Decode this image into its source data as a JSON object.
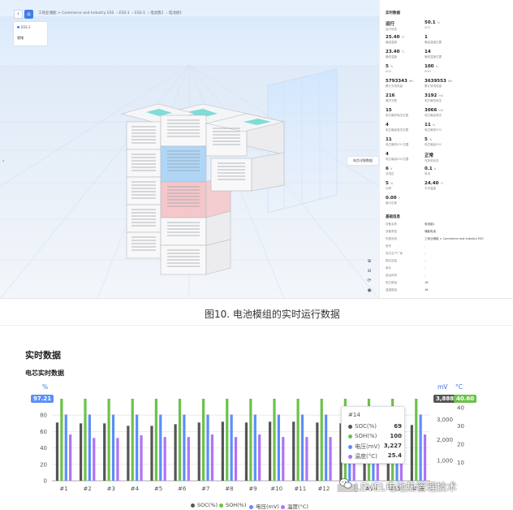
{
  "viewer": {
    "breadcrumb": [
      "工商业储能 > Commerce and Industry ESS",
      "ESS-1",
      "ESS-1",
      "电池簇1",
      "电池组1"
    ],
    "card": {
      "title": "ESS-1",
      "status": "就绪"
    },
    "side_tab_label": "电芯详细数据",
    "panel": {
      "title": "实时数据",
      "metrics": [
        {
          "value": "运行",
          "unit": "",
          "label": "运行状态"
        },
        {
          "value": "50.1",
          "unit": "%",
          "label": "SOC"
        },
        {
          "value": "25.40",
          "unit": "°C",
          "label": "最高温度"
        },
        {
          "value": "1",
          "unit": "",
          "label": "最高温度位置"
        },
        {
          "value": "23.40",
          "unit": "°C",
          "label": "最低温度"
        },
        {
          "value": "14",
          "unit": "",
          "label": "最低温度位置"
        },
        {
          "value": "5",
          "unit": "%",
          "label": "SOC"
        },
        {
          "value": "100",
          "unit": "%",
          "label": "SOH"
        },
        {
          "value": "5793343",
          "unit": "Wh",
          "label": "累计充电电量"
        },
        {
          "value": "3639553",
          "unit": "Wh",
          "label": "累计放电电量"
        },
        {
          "value": "216",
          "unit": "",
          "label": "循环次数"
        },
        {
          "value": "3192",
          "unit": "mV",
          "label": "电芯最低电压"
        },
        {
          "value": "15",
          "unit": "",
          "label": "电芯最低电压位置"
        },
        {
          "value": "3066",
          "unit": "mV",
          "label": "电芯最高电压"
        },
        {
          "value": "4",
          "unit": "",
          "label": "电芯最高电压位置"
        },
        {
          "value": "11",
          "unit": "%",
          "label": "电芯最低SOC"
        },
        {
          "value": "11",
          "unit": "",
          "label": "电芯最低SOC位置"
        },
        {
          "value": "5",
          "unit": "%",
          "label": "电芯最高SOC"
        },
        {
          "value": "4",
          "unit": "",
          "label": "电芯最高SOC位置"
        },
        {
          "value": "正常",
          "unit": "",
          "label": "充放电状态"
        },
        {
          "value": "6",
          "unit": "V",
          "label": "总电压"
        },
        {
          "value": "0.1",
          "unit": "A",
          "label": "电流"
        },
        {
          "value": "5",
          "unit": "%",
          "label": "功率"
        },
        {
          "value": "24.40",
          "unit": "°C",
          "label": "平均温度"
        },
        {
          "value": "0.00",
          "unit": "V",
          "label": "最大压差"
        }
      ],
      "info_title": "基础信息",
      "info": [
        {
          "label": "设备名称",
          "value": "电池组1"
        },
        {
          "label": "设备类型",
          "value": "储能电池"
        },
        {
          "label": "所属系统",
          "value": "工商业储能 > Commerce and Industry ESS"
        },
        {
          "label": "型号",
          "value": "-"
        },
        {
          "label": "电芯生产厂家",
          "value": "-"
        },
        {
          "label": "额定容量",
          "value": "-"
        },
        {
          "label": "串并",
          "value": "-"
        },
        {
          "label": "投运时间",
          "value": "-"
        },
        {
          "label": "电芯数量",
          "value": "16"
        },
        {
          "label": "温度数量",
          "value": "16"
        }
      ]
    }
  },
  "caption_top": "图10. 电池模组的实时运行数据",
  "section": {
    "title": "实时数据",
    "subtitle": "电芯实时数据"
  },
  "axes": {
    "left_unit": "%",
    "right_unit_mv": "mV",
    "right_unit_c": "°C",
    "left_marker": "97.21",
    "right_marker_mv": "3,888.37",
    "right_marker_c": "40.60"
  },
  "tooltip": {
    "title": "#14",
    "rows": [
      {
        "name": "SOC(%)",
        "value": "69",
        "color": "#555555"
      },
      {
        "name": "SOH(%)",
        "value": "100",
        "color": "#6cc24a"
      },
      {
        "name": "电压(mV)",
        "value": "3,227",
        "color": "#5b8ff9"
      },
      {
        "name": "温度(°C)",
        "value": "25.4",
        "color": "#b072f5"
      }
    ]
  },
  "watermark": "LEVEL电池热管理技术",
  "chart_data": {
    "type": "bar",
    "categories": [
      "#1",
      "#2",
      "#3",
      "#4",
      "#5",
      "#6",
      "#7",
      "#8",
      "#9",
      "#10",
      "#11",
      "#12",
      "#13",
      "#14",
      "#15",
      "#16"
    ],
    "series": [
      {
        "name": "SOC(%)",
        "axis": "left",
        "color": "#555555",
        "values": [
          71,
          70,
          70,
          67,
          67,
          69,
          71,
          72,
          71,
          72,
          72,
          71,
          70,
          69,
          70,
          68
        ]
      },
      {
        "name": "SOH(%)",
        "axis": "left",
        "color": "#6cc24a",
        "values": [
          100,
          100,
          100,
          100,
          100,
          100,
          100,
          100,
          100,
          100,
          100,
          100,
          100,
          100,
          100,
          100
        ]
      },
      {
        "name": "电压(mV)",
        "axis": "right_mv",
        "color": "#5b8ff9",
        "values": [
          3227,
          3227,
          3227,
          3227,
          3227,
          3227,
          3227,
          3227,
          3227,
          3227,
          3227,
          3227,
          3227,
          3227,
          3227,
          3227
        ]
      },
      {
        "name": "温度(°C)",
        "axis": "right_c",
        "color": "#b072f5",
        "values": [
          25.4,
          23.5,
          23.5,
          25.0,
          24.0,
          24.0,
          25.4,
          24.0,
          25.4,
          24.0,
          24.0,
          24.0,
          25.4,
          25.4,
          24.0,
          25.4
        ]
      }
    ],
    "y_left": {
      "ticks": [
        0,
        20,
        40,
        60,
        80
      ],
      "ylim": [
        0,
        100
      ]
    },
    "y_right_mv": {
      "ticks": [
        "1,000",
        "2,000",
        "3,000"
      ],
      "ylim": [
        0,
        4000
      ]
    },
    "y_right_c": {
      "ticks": [
        10,
        20,
        30,
        40
      ],
      "ylim": [
        0,
        45
      ]
    },
    "legend": [
      "SOC(%)",
      "SOH(%)",
      "电压(mV)",
      "温度(°C)"
    ]
  }
}
